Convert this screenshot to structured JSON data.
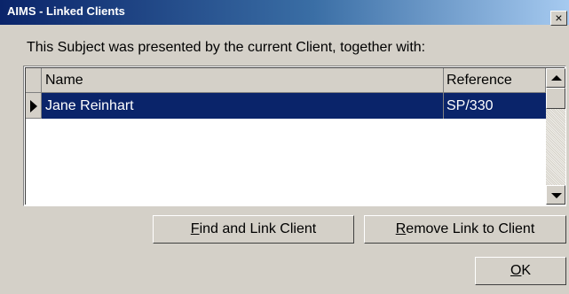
{
  "window": {
    "title": "AIMS - Linked Clients",
    "close_glyph": "×"
  },
  "message": "This Subject was presented by the current Client, together with:",
  "grid": {
    "columns": [
      "Name",
      "Reference"
    ],
    "rows": [
      {
        "name": "Jane Reinhart",
        "reference": "SP/330",
        "selected": true
      }
    ]
  },
  "buttons": {
    "find_access": "F",
    "find_rest": "ind and Link Client",
    "remove_access": "R",
    "remove_rest": "emove Link to Client",
    "ok_access": "O",
    "ok_rest": "K"
  },
  "colors": {
    "title_gradient_start": "#0a246a",
    "selection": "#0a246a",
    "face": "#d4d0c8"
  }
}
